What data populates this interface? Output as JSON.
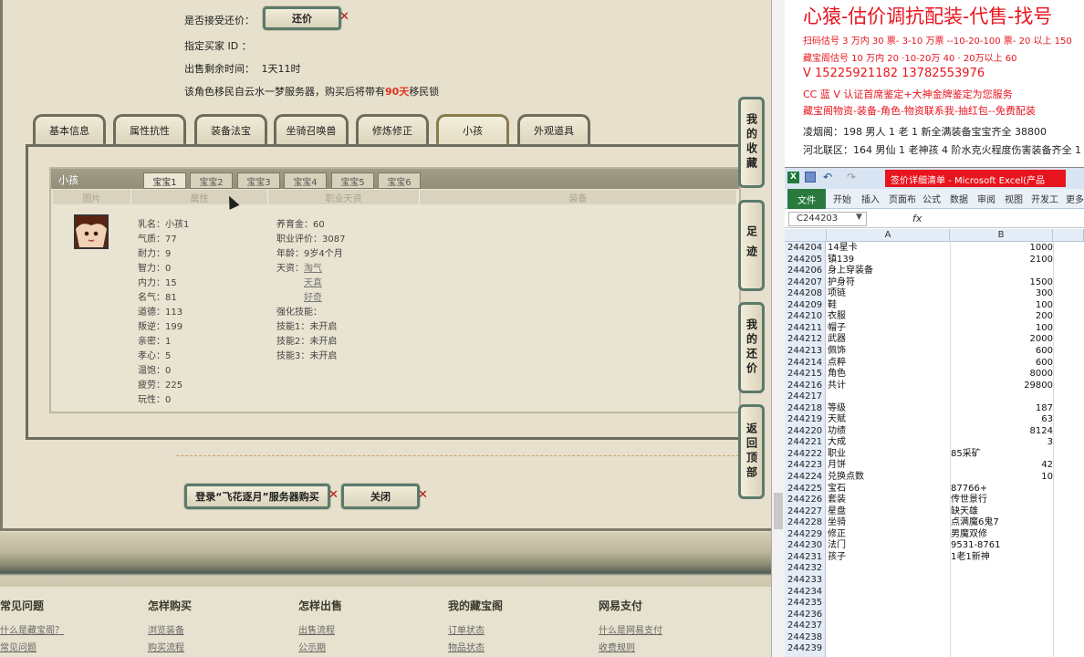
{
  "game": {
    "accept_counter_label": "是否接受还价：",
    "counter_button": "还价",
    "buyer_id_label": "指定买家 ID ：",
    "time_left_label": "出售剩余时间：",
    "time_left_value": "1天11时",
    "migrate_prefix": "该角色移民自云水一梦服务器，购买后将带有",
    "migrate_days": "90天",
    "migrate_suffix": "移民锁",
    "tabs": [
      "基本信息",
      "属性抗性",
      "装备法宝",
      "坐骑召唤兽",
      "修炼修正",
      "小孩",
      "外观道具"
    ],
    "active_tab_index": 5,
    "child_section_label": "小孩",
    "baby_tabs": [
      "宝宝1",
      "宝宝2",
      "宝宝3",
      "宝宝4",
      "宝宝5",
      "宝宝6"
    ],
    "columns": [
      "图片",
      "属性",
      "职业天资",
      "装备"
    ],
    "attributes": [
      "乳名：小孩1",
      "气质：77",
      "耐力：9",
      "智力：0",
      "内力：15",
      "名气：81",
      "道德：113",
      "叛逆：199",
      "亲密：1",
      "孝心：5",
      "温饱：0",
      "疲劳：225",
      "玩性：0"
    ],
    "job_lines": [
      "养育金：60",
      "职业评价：3087",
      "年龄：9岁4个月",
      "天资："
    ],
    "talents": [
      "淘气",
      "天真",
      "好奇"
    ],
    "skill_title": "强化技能：",
    "skills": [
      "技能1：未开启",
      "技能2：未开启",
      "技能3：未开启"
    ],
    "buy_button": "登录“飞花逐月”服务器购买",
    "close_button": "关闭",
    "side_buttons": [
      "我的收藏",
      "足迹",
      "我的还价",
      "返回顶部"
    ],
    "footer_cols": [
      {
        "title": "常见问题",
        "links": [
          "什么是藏宝阁？",
          "常见问题"
        ]
      },
      {
        "title": "怎样购买",
        "links": [
          "浏览装备",
          "购买流程"
        ]
      },
      {
        "title": "怎样出售",
        "links": [
          "出售流程",
          "公示期"
        ]
      },
      {
        "title": "我的藏宝阁",
        "links": [
          "订单状态",
          "物品状态"
        ]
      },
      {
        "title": "网易支付",
        "links": [
          "什么是网易支付",
          "收费规则"
        ]
      }
    ]
  },
  "ad": {
    "headline": "心猿-估价调抗配装-代售-找号",
    "lines": [
      "扫码估号 3 万内 30 票- 3-10 万票 --10-20-100 票- 20 以上 150",
      "藏宝阁估号 10 万内 20 ·10-20万 40 · 20万以上 60",
      "V 15225921182      13782553976",
      "CC 蓝 V 认证首席鉴定+大神金牌鉴定为您服务",
      "藏宝阁物资-装备-角色-物资联系我-抽红包--免费配装",
      "凌烟阁：198 男人 1 老 1 新全满装备宝宝齐全 38800",
      "河北联区：164 男仙 1 老神孩 4 阶水克火程度伤害装备齐全 1"
    ]
  },
  "excel": {
    "window_title": "签价详细清单 - Microsoft Excel(产品",
    "ribbon_tabs": [
      "文件",
      "开始",
      "插入",
      "页面布",
      "公式",
      "数据",
      "审阅",
      "视图",
      "开发工",
      "更多"
    ],
    "name_box": "C244203",
    "fx": "fx",
    "col_a": "A",
    "col_b": "B",
    "rows": [
      {
        "n": "244204",
        "a": "14星卡",
        "b": "1000",
        "num": true
      },
      {
        "n": "244205",
        "a": "镇139",
        "b": "2100",
        "num": true
      },
      {
        "n": "244206",
        "a": "身上穿装备",
        "b": "",
        "num": true
      },
      {
        "n": "244207",
        "a": "护身符",
        "b": "1500",
        "num": true
      },
      {
        "n": "244208",
        "a": "项链",
        "b": "300",
        "num": true
      },
      {
        "n": "244209",
        "a": "鞋",
        "b": "100",
        "num": true
      },
      {
        "n": "244210",
        "a": "衣服",
        "b": "200",
        "num": true
      },
      {
        "n": "244211",
        "a": "帽子",
        "b": "100",
        "num": true
      },
      {
        "n": "244212",
        "a": "武器",
        "b": "2000",
        "num": true
      },
      {
        "n": "244213",
        "a": "佩饰",
        "b": "600",
        "num": true
      },
      {
        "n": "244214",
        "a": "点粹",
        "b": "600",
        "num": true
      },
      {
        "n": "244215",
        "a": "角色",
        "b": "8000",
        "num": true
      },
      {
        "n": "244216",
        "a": "共计",
        "b": "29800",
        "num": true
      },
      {
        "n": "244217",
        "a": "",
        "b": "",
        "num": true
      },
      {
        "n": "244218",
        "a": "等级",
        "b": "187",
        "num": true
      },
      {
        "n": "244219",
        "a": "天赋",
        "b": "63",
        "num": true
      },
      {
        "n": "244220",
        "a": "功绩",
        "b": "8124",
        "num": true
      },
      {
        "n": "244221",
        "a": "大成",
        "b": "3",
        "num": true
      },
      {
        "n": "244222",
        "a": "职业",
        "b": "85采矿",
        "num": false
      },
      {
        "n": "244223",
        "a": "月饼",
        "b": "42",
        "num": true
      },
      {
        "n": "244224",
        "a": "兑换点数",
        "b": "10",
        "num": true
      },
      {
        "n": "244225",
        "a": "宝石",
        "b": "87766+",
        "num": false
      },
      {
        "n": "244226",
        "a": "套装",
        "b": "传世景行",
        "num": false
      },
      {
        "n": "244227",
        "a": "星盘",
        "b": "缺天雄",
        "num": false
      },
      {
        "n": "244228",
        "a": "坐骑",
        "b": "点满魔6鬼7",
        "num": false
      },
      {
        "n": "244229",
        "a": "修正",
        "b": "男魔双修",
        "num": false
      },
      {
        "n": "244230",
        "a": "法门",
        "b": "9531-8761",
        "num": false
      },
      {
        "n": "244231",
        "a": "孩子",
        "b": "1老1新神",
        "num": false
      },
      {
        "n": "244232",
        "a": "",
        "b": "",
        "num": true
      },
      {
        "n": "244233",
        "a": "",
        "b": "",
        "num": true
      },
      {
        "n": "244234",
        "a": "",
        "b": "",
        "num": true
      },
      {
        "n": "244235",
        "a": "",
        "b": "",
        "num": true
      },
      {
        "n": "244236",
        "a": "",
        "b": "",
        "num": true
      },
      {
        "n": "244237",
        "a": "",
        "b": "",
        "num": true
      },
      {
        "n": "244238",
        "a": "",
        "b": "",
        "num": true
      },
      {
        "n": "244239",
        "a": "",
        "b": "",
        "num": true
      }
    ]
  },
  "colors": {
    "ad_red": "#e8141e",
    "migrate_red": "#e0321e",
    "excel_green": "#2a7a3d",
    "frame_teal": "#5b7a6e"
  }
}
